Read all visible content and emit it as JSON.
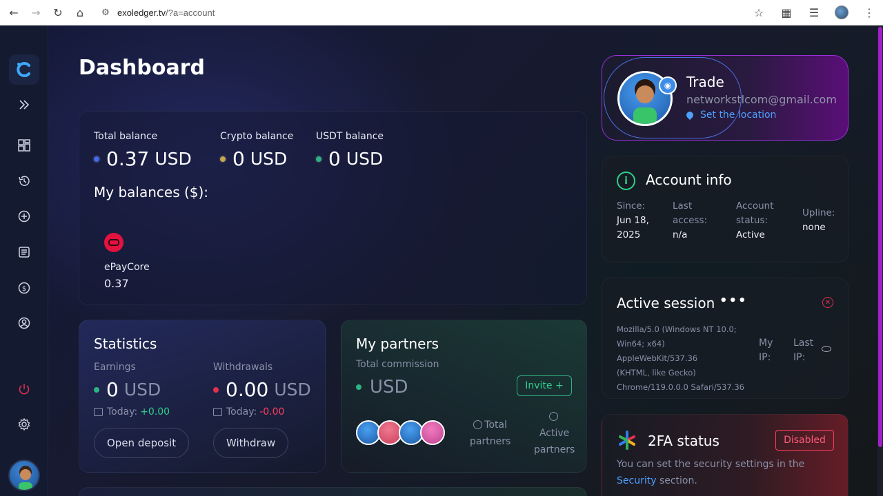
{
  "browser": {
    "url_host": "exoledger.tv",
    "url_path": "/?a=account"
  },
  "page": {
    "title": "Dashboard"
  },
  "balances": {
    "total": {
      "label": "Total balance",
      "amount": "0.37",
      "currency": "USD",
      "dot_color": "#3f6ae8"
    },
    "crypto": {
      "label": "Crypto balance",
      "amount": "0",
      "currency": "USD",
      "dot_color": "#c7a84a"
    },
    "usdt": {
      "label": "USDT balance",
      "amount": "0",
      "currency": "USD",
      "dot_color": "#2fb383"
    },
    "my_balances_title": "My balances ($):",
    "items": [
      {
        "name": "ePayCore",
        "amount": "0.37"
      }
    ]
  },
  "statistics": {
    "title": "Statistics",
    "earnings": {
      "label": "Earnings",
      "amount": "0",
      "currency": "USD",
      "today_label": "Today:",
      "today_value": "+0.00"
    },
    "withdrawals": {
      "label": "Withdrawals",
      "amount": "0.00",
      "currency": "USD",
      "today_label": "Today:",
      "today_value": "-0.00"
    },
    "open_deposit": "Open deposit",
    "withdraw": "Withdraw"
  },
  "partners": {
    "title": "My partners",
    "subtitle": "Total commission",
    "currency": "USD",
    "invite": "Invite +",
    "total_line1": "Total",
    "total_line2": "partners",
    "active_line1": "Active",
    "active_line2": "partners"
  },
  "profile": {
    "name": "Trade",
    "email": "networkstlcom@gmail.com",
    "location_link": "Set the location"
  },
  "account_info": {
    "title": "Account info",
    "since_label": "Since:",
    "since_value_1": "Jun 18,",
    "since_value_2": "2025",
    "last_access_1": "Last",
    "last_access_2": "access:",
    "last_access_value": "n/a",
    "status_1": "Account",
    "status_2": "status:",
    "status_value": "Active",
    "upline_label": "Upline:",
    "upline_value": "none"
  },
  "session": {
    "title": "Active session",
    "more": "•••",
    "ua_1": "Mozilla/5.0 (Windows NT 10.0;",
    "ua_2": "Win64; x64) AppleWebKit/537.36",
    "ua_3": "(KHTML, like Gecko)",
    "ua_4": "Chrome/119.0.0.0 Safari/537.36",
    "my_ip_1": "My",
    "my_ip_2": "IP:",
    "last_ip_1": "Last",
    "last_ip_2": "IP:"
  },
  "tfa": {
    "title": "2FA status",
    "badge": "Disabled",
    "msg_before": "You can set the security settings in the ",
    "msg_link": "Security",
    "msg_after": " section."
  }
}
